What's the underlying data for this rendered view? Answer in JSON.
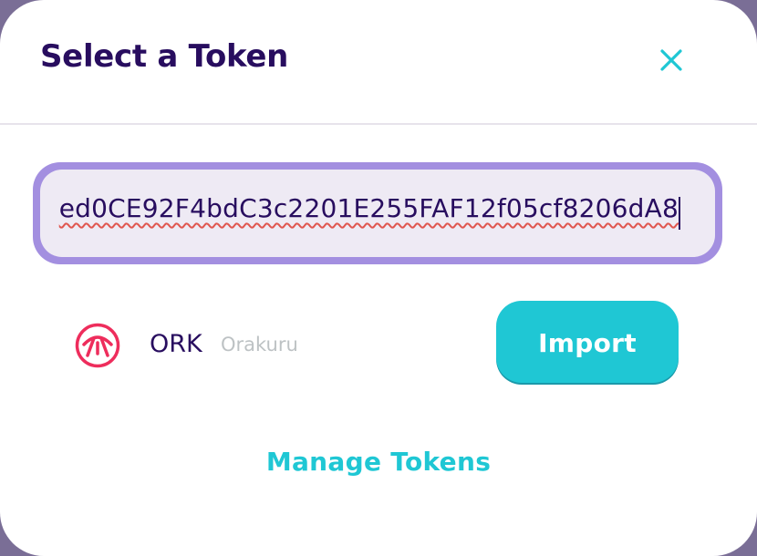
{
  "modal": {
    "title": "Select a Token",
    "close_icon": "close-icon"
  },
  "search": {
    "value": "ed0CE92F4bdC3c2201E255FAF12f05cf8206dA8"
  },
  "token": {
    "logo_icon": "orakuru-logo-icon",
    "symbol": "ORK",
    "name": "Orakuru",
    "import_label": "Import"
  },
  "footer": {
    "manage_label": "Manage Tokens"
  },
  "colors": {
    "title": "#280d5f",
    "accent": "#1fc7d4",
    "input_focus": "#a38fe0",
    "input_bg": "#eeeaf4",
    "token_logo": "#ee2d5c"
  }
}
